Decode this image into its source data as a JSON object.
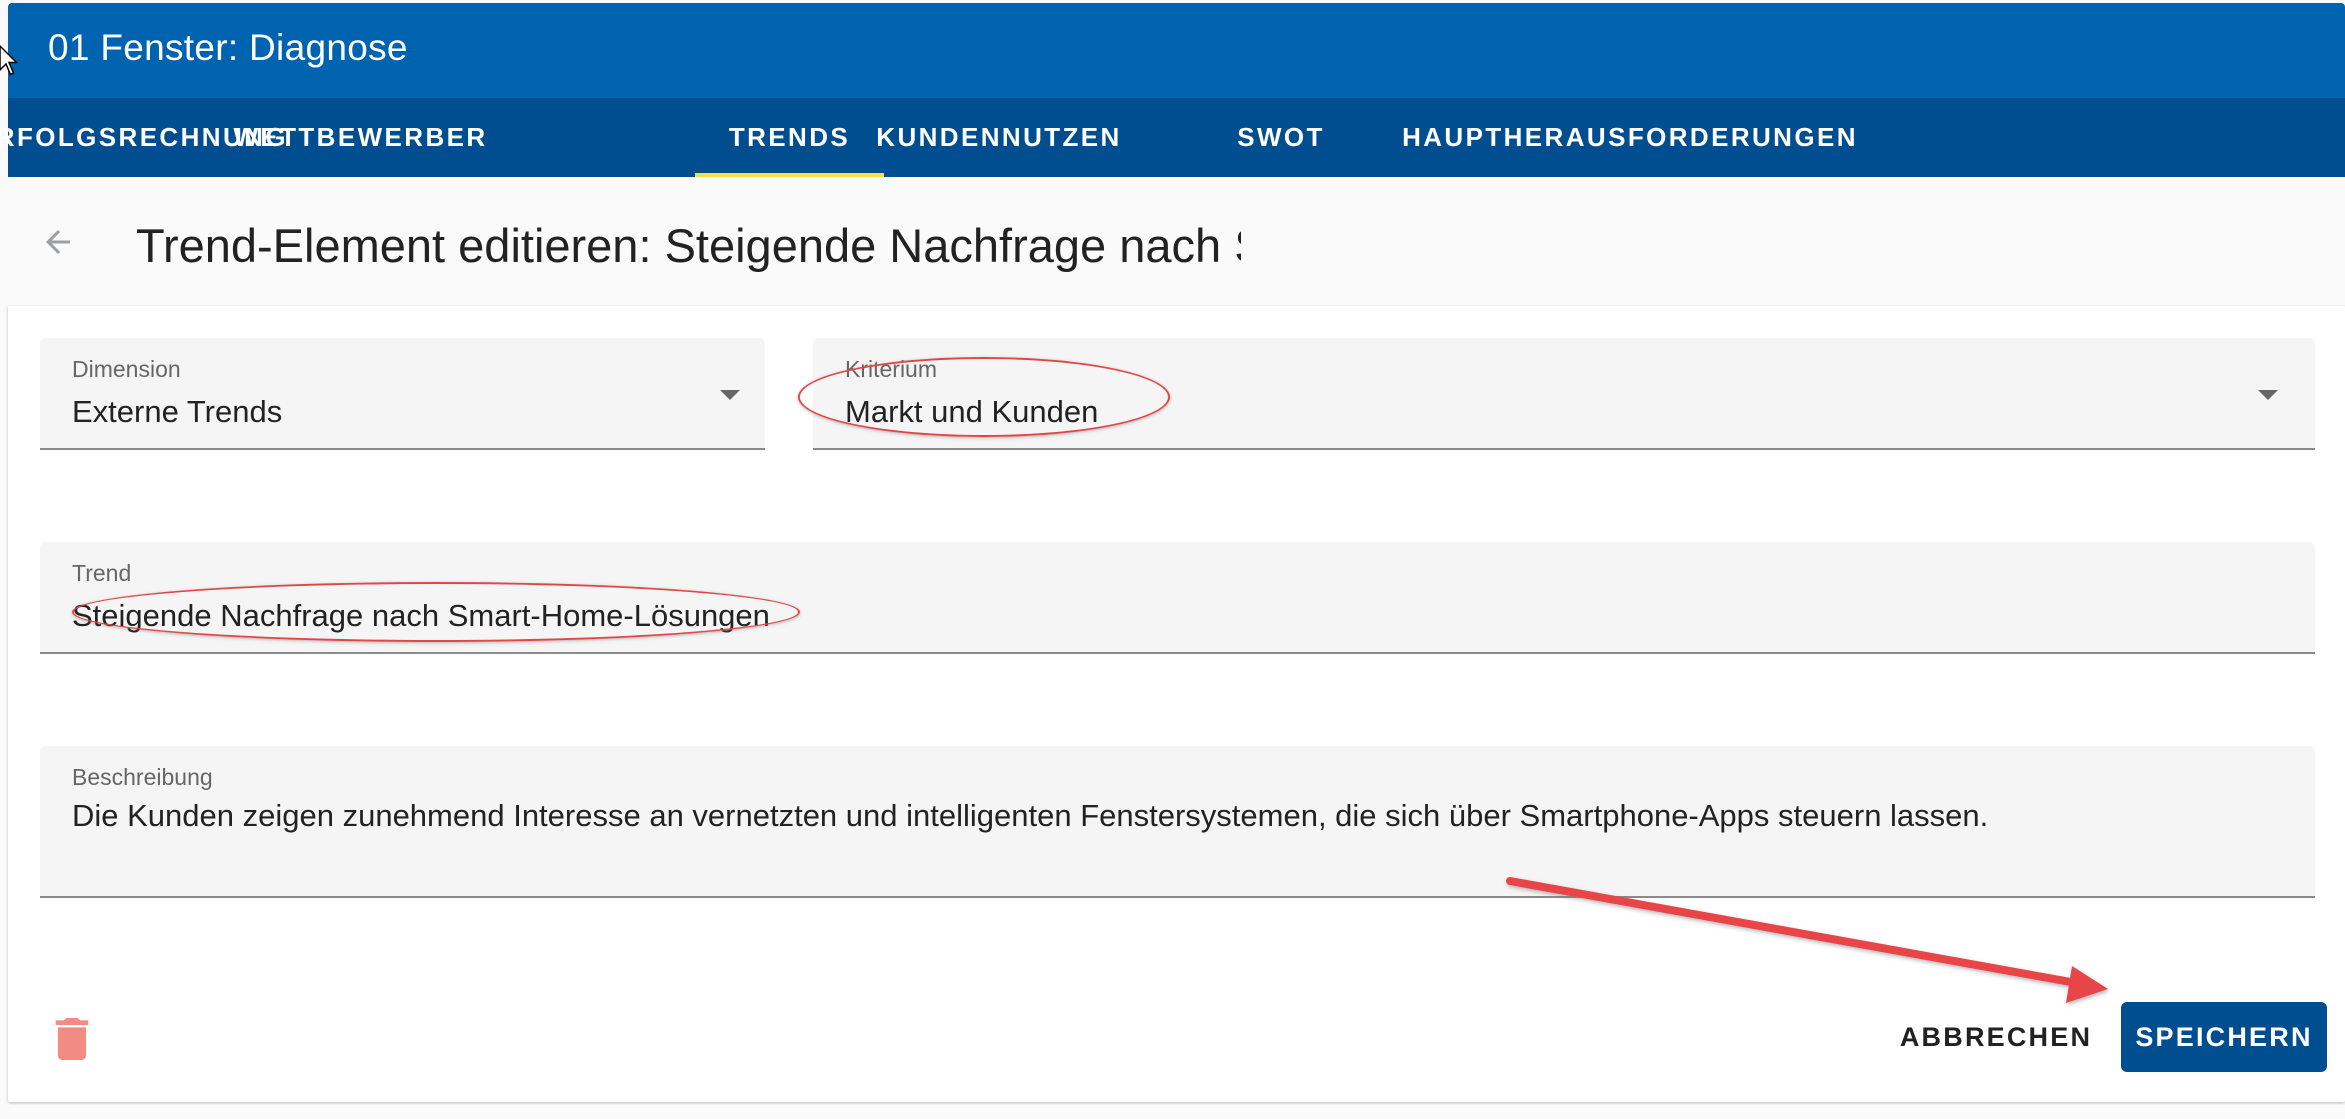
{
  "header": {
    "title": "01 Fenster: Diagnose",
    "tabs": [
      {
        "label": "ERFOLGSRECHNUNG",
        "active": false
      },
      {
        "label": "WETTBEWERBER",
        "active": false
      },
      {
        "label": "TRENDS",
        "active": true
      },
      {
        "label": "KUNDENNUTZEN",
        "active": false
      },
      {
        "label": "SWOT",
        "active": false
      },
      {
        "label": "HAUPTHERAUSFORDERUNGEN",
        "active": false
      }
    ]
  },
  "page": {
    "title": "Trend-Element editieren: Steigende Nachfrage nach Smart-Home-Lösungen",
    "back_icon": "arrow-left-icon"
  },
  "form": {
    "dimension": {
      "label": "Dimension",
      "value": "Externe Trends"
    },
    "kriterium": {
      "label": "Kriterium",
      "value": "Markt und Kunden"
    },
    "trend": {
      "label": "Trend",
      "value": "Steigende Nachfrage nach Smart-Home-Lösungen"
    },
    "beschreibung": {
      "label": "Beschreibung",
      "value": "Die Kunden zeigen zunehmend Interesse an vernetzten und intelligenten Fenstersystemen, die sich über Smartphone-Apps steuern lassen."
    }
  },
  "actions": {
    "delete_icon": "trash-icon",
    "cancel_label": "ABBRECHEN",
    "save_label": "SPEICHERN"
  },
  "colors": {
    "header": "#0063b0",
    "tabbar": "#004e8f",
    "tab_indicator": "#f6e04a",
    "primary_button": "#004e8f",
    "delete_icon": "#f28b82",
    "annotation": "#e04848"
  }
}
